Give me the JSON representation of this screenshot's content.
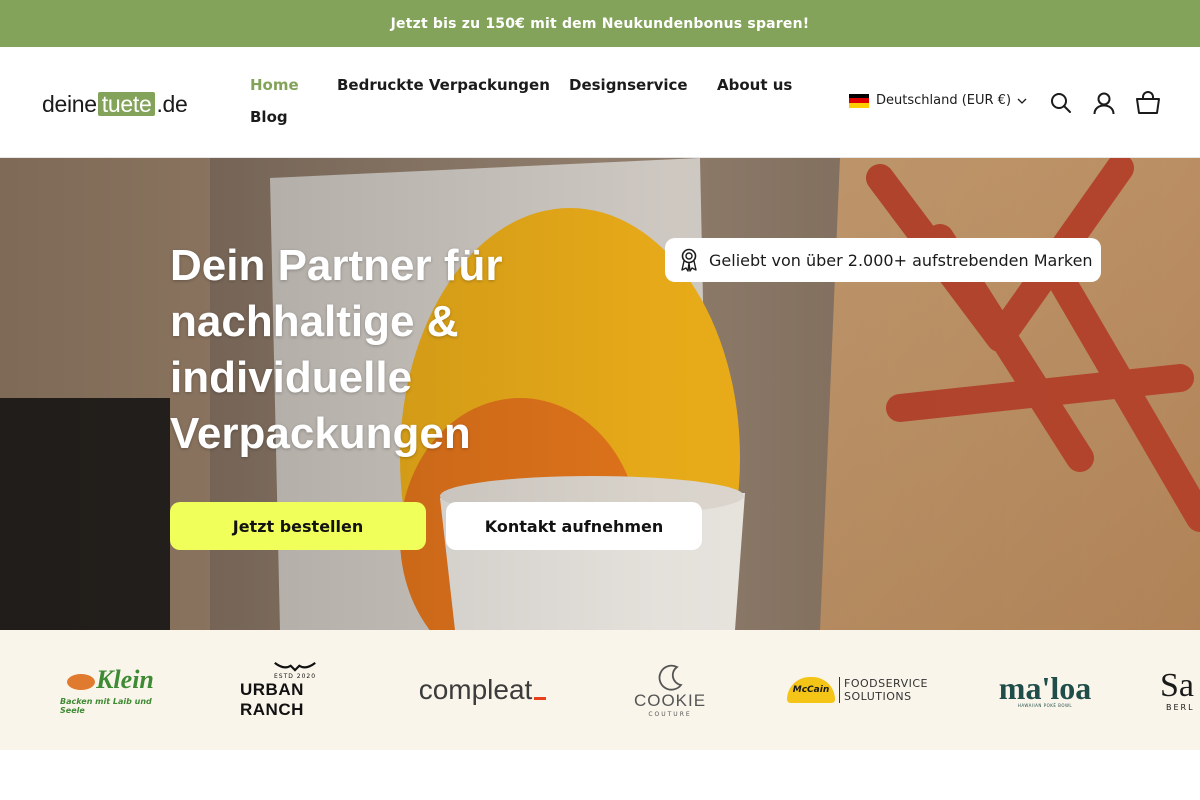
{
  "announcement": {
    "text": "Jetzt bis zu 150€ mit dem Neukundenbonus sparen!"
  },
  "header": {
    "logo": {
      "part1": "deine",
      "part2": "tuete",
      "part3": ".de"
    },
    "nav": [
      {
        "label": "Home",
        "active": true
      },
      {
        "label": "Bedruckte Verpackungen",
        "active": false
      },
      {
        "label": "Designservice",
        "active": false
      },
      {
        "label": "About us",
        "active": false
      },
      {
        "label": "Blog",
        "active": false
      }
    ],
    "locale": {
      "label": "Deutschland (EUR €)",
      "flag_icon": "germany-flag-icon"
    },
    "icons": [
      "search-icon",
      "account-icon",
      "cart-icon"
    ]
  },
  "hero": {
    "title": "Dein Partner für nachhaltige & individuelle Verpackungen",
    "badge": "Geliebt von über 2.000+ aufstrebenden Marken",
    "primary_button": "Jetzt bestellen",
    "secondary_button": "Kontakt aufnehmen"
  },
  "brands": {
    "klein": {
      "name": "Klein",
      "tagline": "Backen mit Laib und Seele"
    },
    "urban_ranch": {
      "est": "ESTD 2020",
      "name": "URBAN RANCH"
    },
    "compleat": {
      "name": "compleat"
    },
    "cookie": {
      "name": "COOKIE",
      "sub": "COUTURE"
    },
    "mccain": {
      "mark": "McCain",
      "line1": "FOODSERVICE",
      "line2": "SOLUTIONS"
    },
    "maloa": {
      "name": "ma'loa",
      "sub": "HAWAIIAN POKÉ BOWL"
    },
    "partial": {
      "name": "Sa",
      "sub": "BERL"
    }
  },
  "colors": {
    "brand_green": "#84a35a",
    "cta_yellow": "#f0ff59",
    "strip_background": "#faf5ea"
  }
}
